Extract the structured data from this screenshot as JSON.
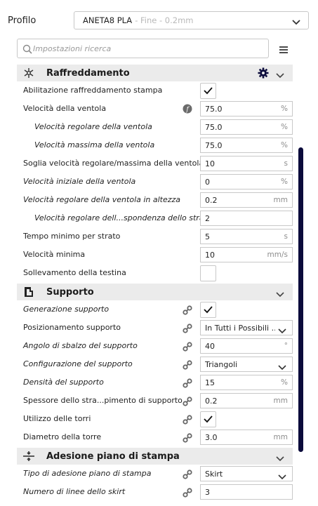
{
  "profile": {
    "label": "Profilo",
    "name": "ANETA8 PLA",
    "variant": "- Fine - 0.2mm"
  },
  "search": {
    "placeholder": "Impostazioni ricerca"
  },
  "categories": {
    "cooling": {
      "title": "Raffreddamento",
      "rows": [
        {
          "label": "Abilitazione raffreddamento stampa",
          "checked": true
        },
        {
          "label": "Velocità della ventola",
          "value": "75.0",
          "unit": "%"
        },
        {
          "label": "Velocità regolare della ventola",
          "value": "75.0",
          "unit": "%"
        },
        {
          "label": "Velocità massima della ventola",
          "value": "75.0",
          "unit": "%"
        },
        {
          "label": "Soglia velocità regolare/massima della ventola",
          "value": "10",
          "unit": "s"
        },
        {
          "label": "Velocità iniziale della ventola",
          "value": "0",
          "unit": "%"
        },
        {
          "label": "Velocità regolare della ventola in altezza",
          "value": "0.2",
          "unit": "mm"
        },
        {
          "label": "Velocità regolare dell...spondenza dello strato",
          "value": "2",
          "unit": ""
        },
        {
          "label": "Tempo minimo per strato",
          "value": "5",
          "unit": "s"
        },
        {
          "label": "Velocità minima",
          "value": "10",
          "unit": "mm/s"
        },
        {
          "label": "Sollevamento della testina",
          "checked": false
        }
      ]
    },
    "support": {
      "title": "Supporto",
      "rows": [
        {
          "label": "Generazione supporto",
          "checked": true
        },
        {
          "label": "Posizionamento supporto",
          "value": "In Tutti i Possibili ..."
        },
        {
          "label": "Angolo di sbalzo del supporto",
          "value": "40",
          "unit": "°"
        },
        {
          "label": "Configurazione del supporto",
          "value": "Triangoli"
        },
        {
          "label": "Densità del supporto",
          "value": "15",
          "unit": "%"
        },
        {
          "label": "Spessore dello stra...pimento di supporto",
          "value": "0.2",
          "unit": "mm"
        },
        {
          "label": "Utilizzo delle torri",
          "checked": true
        },
        {
          "label": "Diametro della torre",
          "value": "3.0",
          "unit": "mm"
        }
      ]
    },
    "adhesion": {
      "title": "Adesione piano di stampa",
      "rows": [
        {
          "label": "Tipo di adesione piano di stampa",
          "value": "Skirt"
        },
        {
          "label": "Numero di linee dello skirt",
          "value": "3",
          "unit": ""
        }
      ]
    }
  },
  "colors": {
    "accent": "#0b0b3b",
    "header_bg": "#ebebeb",
    "border": "#c8c8c8"
  },
  "icons": [
    "chevron-down-icon",
    "search-icon",
    "menu-icon",
    "fan-icon",
    "gear-icon",
    "support-icon",
    "adhesion-icon",
    "link-icon",
    "fx-icon",
    "check-icon"
  ]
}
